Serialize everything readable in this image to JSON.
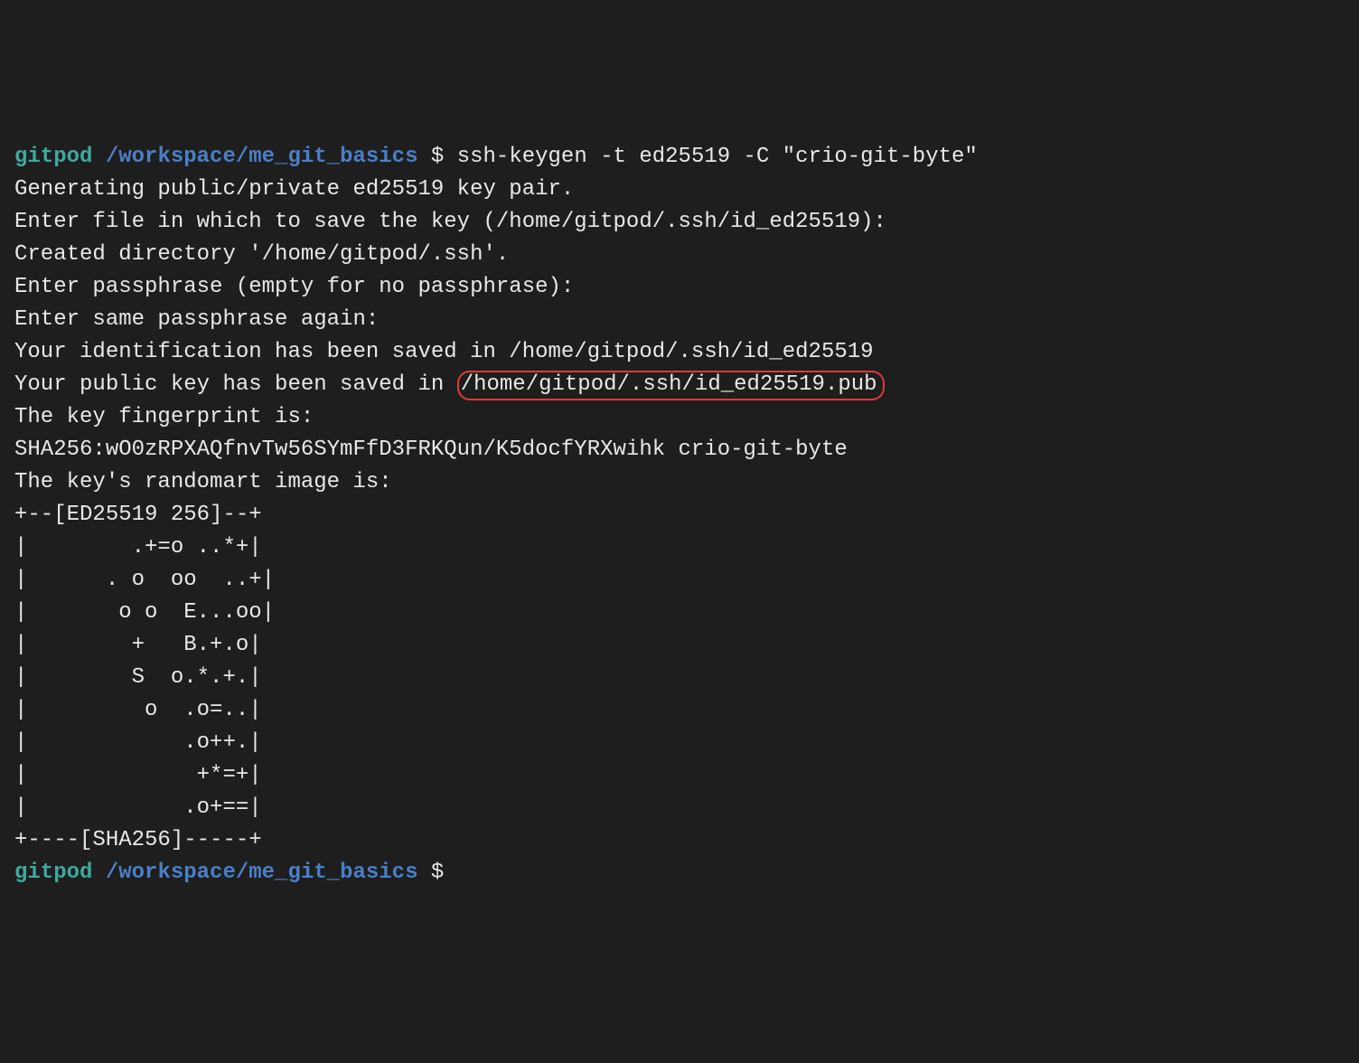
{
  "prompt1": {
    "user": "gitpod",
    "path": "/workspace/me_git_basics",
    "dollar": "$",
    "command": "ssh-keygen -t ed25519 -C \"crio-git-byte\""
  },
  "output": {
    "line1": "Generating public/private ed25519 key pair.",
    "line2": "Enter file in which to save the key (/home/gitpod/.ssh/id_ed25519): ",
    "line3": "Created directory '/home/gitpod/.ssh'.",
    "line4": "Enter passphrase (empty for no passphrase): ",
    "line5": "Enter same passphrase again: ",
    "line6": "Your identification has been saved in /home/gitpod/.ssh/id_ed25519",
    "line7_prefix": "Your public key has been saved in ",
    "line7_highlight": "/home/gitpod/.ssh/id_ed25519.pub",
    "line8": "The key fingerprint is:",
    "line9": "SHA256:wO0zRPXAQfnvTw56SYmFfD3FRKQun/K5docfYRXwihk crio-git-byte",
    "line10": "The key's randomart image is:",
    "art1": "+--[ED25519 256]--+",
    "art2": "|        .+=o ..*+|",
    "art3": "|      . o  oo  ..+|",
    "art4": "|       o o  E...oo|",
    "art5": "|        +   B.+.o|",
    "art6": "|        S  o.*.+.|",
    "art7": "|         o  .o=..|",
    "art8": "|            .o++.|",
    "art9": "|             +*=+|",
    "art10": "|            .o+==|",
    "art11": "+----[SHA256]-----+"
  },
  "prompt2": {
    "user": "gitpod",
    "path": "/workspace/me_git_basics",
    "dollar": "$"
  }
}
